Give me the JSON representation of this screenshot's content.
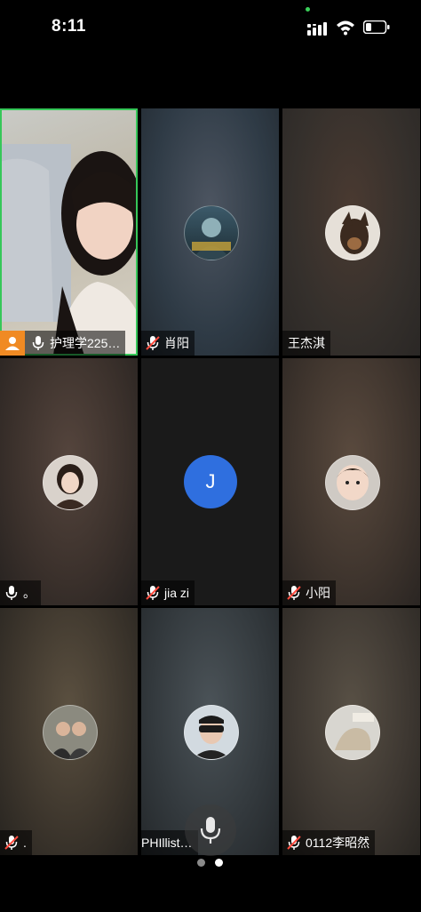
{
  "status_bar": {
    "time": "8:11"
  },
  "participants": [
    {
      "name": "护理学225…",
      "muted": false,
      "host": true,
      "active": true
    },
    {
      "name": "肖阳",
      "muted": true
    },
    {
      "name": "王杰淇",
      "muted": null
    },
    {
      "name": "。",
      "muted": false
    },
    {
      "name": "jia zi",
      "muted": true,
      "initial": "J"
    },
    {
      "name": "小阳",
      "muted": true
    },
    {
      "name": ".",
      "muted": true
    },
    {
      "name": "PHIllist…",
      "muted": null
    },
    {
      "name": "0112李昭然",
      "muted": true
    }
  ],
  "pager": {
    "pages": 2,
    "current": 2
  },
  "colors": {
    "accent": "#36c759",
    "initial_avatar": "#2f6fdf",
    "host_badge": "#f08a23"
  }
}
